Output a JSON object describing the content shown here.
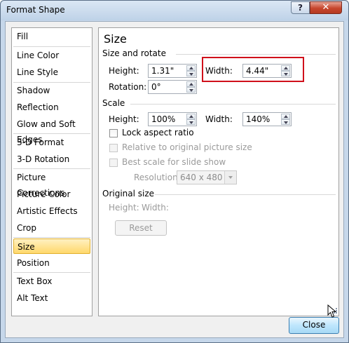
{
  "window": {
    "title": "Format Shape",
    "help": "?",
    "close": "✕"
  },
  "nav": {
    "items": [
      {
        "label": "Fill"
      },
      {
        "label": "Line Color"
      },
      {
        "label": "Line Style"
      },
      {
        "label": "Shadow"
      },
      {
        "label": "Reflection"
      },
      {
        "label": "Glow and Soft Edges"
      },
      {
        "label": "3-D Format"
      },
      {
        "label": "3-D Rotation"
      },
      {
        "label": "Picture Corrections"
      },
      {
        "label": "Picture Color"
      },
      {
        "label": "Artistic Effects"
      },
      {
        "label": "Crop"
      },
      {
        "label": "Size"
      },
      {
        "label": "Position"
      },
      {
        "label": "Text Box"
      },
      {
        "label": "Alt Text"
      }
    ],
    "selected": "Size"
  },
  "panel": {
    "title": "Size",
    "size_rotate": {
      "heading": "Size and rotate",
      "height_label": "Height:",
      "height_value": "1.31\"",
      "width_label": "Width:",
      "width_value": "4.44\"",
      "rotation_label": "Rotation:",
      "rotation_value": "0°"
    },
    "scale": {
      "heading": "Scale",
      "height_label": "Height:",
      "height_value": "100%",
      "width_label": "Width:",
      "width_value": "140%",
      "lock_aspect": "Lock aspect ratio",
      "relative": "Relative to original picture size",
      "best_scale": "Best scale for slide show",
      "resolution_label": "Resolution",
      "resolution_value": "640 x 480"
    },
    "original": {
      "heading": "Original size",
      "height_label": "Height:",
      "width_label": "Width:",
      "reset": "Reset"
    }
  },
  "footer": {
    "close": "Close"
  },
  "colors": {
    "highlight": "#d0101b",
    "selected_nav": "#ffd86b"
  }
}
